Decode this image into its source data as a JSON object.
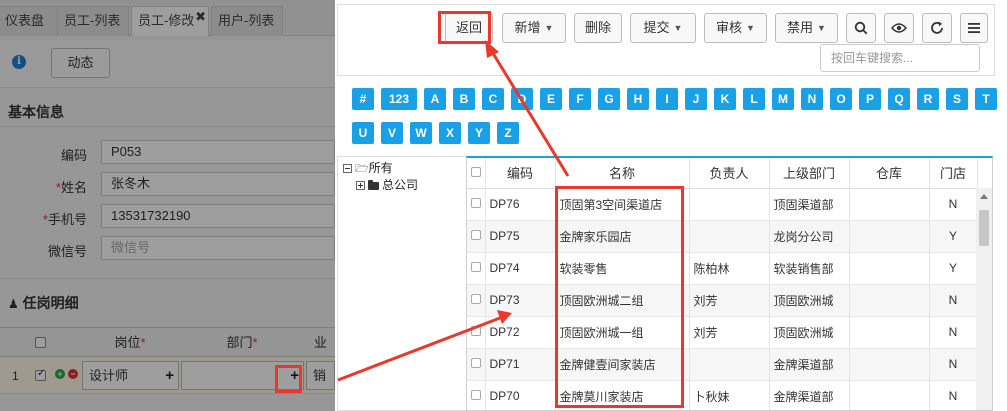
{
  "tabs": [
    {
      "label": "仪表盘"
    },
    {
      "label": "员工-列表"
    },
    {
      "label": "员工-修改"
    },
    {
      "label": "用户-列表"
    }
  ],
  "bg": {
    "dynamic_button": "动态",
    "section_basic": "基本信息",
    "fields": [
      {
        "label": "编码",
        "required": false,
        "value": "P053",
        "placeholder": ""
      },
      {
        "label": "姓名",
        "required": true,
        "value": "张冬木",
        "placeholder": ""
      },
      {
        "label": "手机号",
        "required": true,
        "value": "13531732190",
        "placeholder": ""
      },
      {
        "label": "微信号",
        "required": false,
        "value": "",
        "placeholder": "微信号"
      }
    ],
    "section_job": "任岗明细",
    "grid_headers": {
      "post": "岗位",
      "dept": "部门",
      "extra": "业"
    },
    "grid_row": {
      "index": "1",
      "post": "设计师",
      "dept": "",
      "extra": "销售"
    }
  },
  "toolbar": {
    "back": "返回",
    "add": "新增",
    "delete": "删除",
    "submit": "提交",
    "audit": "审核",
    "disable": "禁用",
    "search_placeholder": "按回车键搜索..."
  },
  "letters": [
    "#",
    "123",
    "A",
    "B",
    "C",
    "D",
    "E",
    "F",
    "G",
    "H",
    "I",
    "J",
    "K",
    "L",
    "M",
    "N",
    "O",
    "P",
    "Q",
    "R",
    "S",
    "T",
    "U",
    "V",
    "W",
    "X",
    "Y",
    "Z"
  ],
  "tree": {
    "root": "所有",
    "child": "总公司"
  },
  "table": {
    "headers": [
      "编码",
      "名称",
      "负责人",
      "上级部门",
      "仓库",
      "门店"
    ],
    "rows": [
      [
        "DP76",
        "顶固第3空间渠道店",
        "",
        "顶固渠道部",
        "",
        "N"
      ],
      [
        "DP75",
        "金牌家乐园店",
        "",
        "龙岗分公司",
        "",
        "Y"
      ],
      [
        "DP74",
        "软装零售",
        "陈柏林",
        "软装销售部",
        "",
        "Y"
      ],
      [
        "DP73",
        "顶固欧洲城二组",
        "刘芳",
        "顶固欧洲城",
        "",
        "N"
      ],
      [
        "DP72",
        "顶固欧洲城一组",
        "刘芳",
        "顶固欧洲城",
        "",
        "N"
      ],
      [
        "DP71",
        "金牌健壹间家装店",
        "",
        "金牌渠道部",
        "",
        "N"
      ],
      [
        "DP70",
        "金牌莫川家装店",
        "卜秋妹",
        "金牌渠道部",
        "",
        "N"
      ]
    ]
  },
  "colors": {
    "accent": "#1aa0e6",
    "highlight": "#e8392c"
  }
}
